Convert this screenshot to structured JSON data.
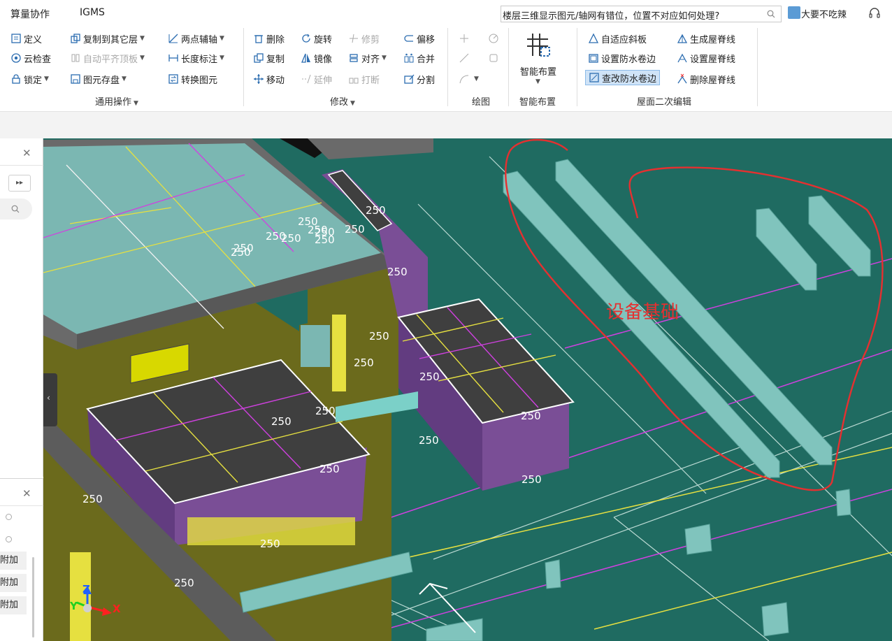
{
  "menu": {
    "items": [
      "算量协作",
      "IGMS"
    ],
    "search_text": "楼层三维显示图元/轴网有错位，位置不对应如何处理?",
    "user_name": "大要不吃辣"
  },
  "ribbon": {
    "general": {
      "define": "定义",
      "copy_to_layer": "复制到其它层",
      "two_point_axis": "两点辅轴",
      "cloud_check": "云检查",
      "auto_flush": "自动平齐顶板",
      "length_dim": "长度标注",
      "lock": "锁定",
      "element_store": "图元存盘",
      "convert_element": "转换图元",
      "group_label": "通用操作"
    },
    "modify": {
      "delete": "删除",
      "rotate": "旋转",
      "trim": "修剪",
      "offset": "偏移",
      "copy": "复制",
      "mirror": "镜像",
      "align": "对齐",
      "merge": "合并",
      "move": "移动",
      "extend": "延伸",
      "break": "打断",
      "split": "分割",
      "group_label": "修改"
    },
    "draw": {
      "group_label": "绘图"
    },
    "smart": {
      "button_label": "智能布置",
      "group_label": "智能布置"
    },
    "roof": {
      "adaptive_slope": "自适应斜板",
      "gen_ridge": "生成屋脊线",
      "set_waterproof_edge": "设置防水卷边",
      "set_ridge": "设置屋脊线",
      "check_waterproof_edge": "查改防水卷边",
      "delete_ridge": "删除屋脊线",
      "group_label": "屋面二次编辑"
    }
  },
  "left_panel": {
    "attach_items": [
      "附加",
      "附加",
      "附加"
    ]
  },
  "viewport": {
    "dimension_labels": [
      "250",
      "250",
      "250",
      "250",
      "250",
      "250",
      "250",
      "250",
      "250",
      "250",
      "250",
      "250",
      "250",
      "250",
      "250",
      "250",
      "250",
      "250",
      "250",
      "250",
      "250",
      "250",
      "250"
    ],
    "annotation_label": "设备基础",
    "axis_z": "Z",
    "axis_y": "Y",
    "axis_x": "X"
  },
  "colors": {
    "ground": "#1f6b61",
    "wall_olive": "#6b6a1c",
    "box_purple": "#7a4e96",
    "slab_teal": "#79b8b1",
    "annotation_red": "#e53030"
  }
}
